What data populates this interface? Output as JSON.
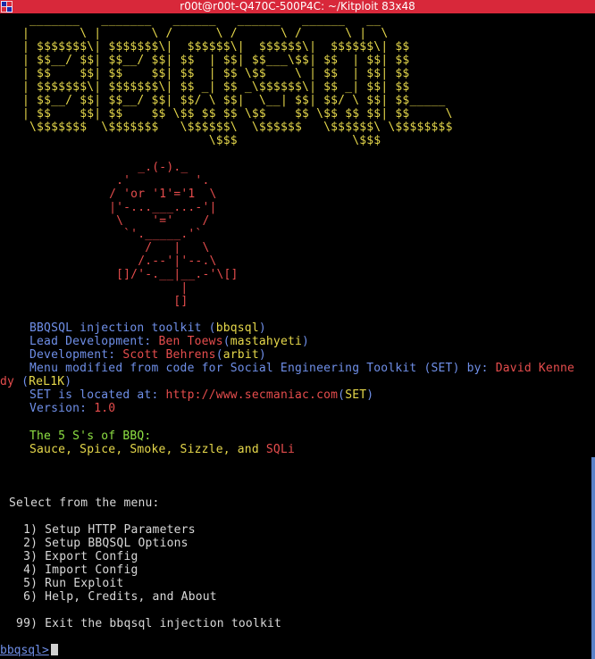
{
  "window": {
    "title": "r00t@r00t-Q470C-500P4C: ~/Kitploit 83x48"
  },
  "ascii_logo": [
    " _______   _______   ______   ______   ______   __",
    "|       \\ |       \\ /      \\ /      \\ /      \\ |  \\",
    "| $$$$$$$\\| $$$$$$$\\|  $$$$$$\\|  $$$$$$\\|  $$$$$$\\| $$",
    "| $$__/ $$| $$__/ $$| $$  | $$| $$___\\$$| $$  | $$| $$",
    "| $$    $$| $$    $$| $$  | $$ \\$$    \\ | $$  | $$| $$",
    "| $$$$$$$\\| $$$$$$$\\| $$ _| $$ _\\$$$$$$\\| $$ _| $$| $$",
    "| $$__/ $$| $$__/ $$| $$/ \\ $$|  \\__| $$| $$/ \\ $$| $$_____",
    "| $$    $$| $$    $$ \\$$ $$ $$ \\$$    $$ \\$$ $$ $$| $$     \\",
    " \\$$$$$$$  \\$$$$$$$   \\$$$$$$\\  \\$$$$$$   \\$$$$$$\\ \\$$$$$$$$",
    "                          \\$$$                \\$$$"
  ],
  "ascii_grill": [
    "        _.(-)._",
    "     .'         '.",
    "    / 'or '1'='1  \\",
    "    |'-...___...-'|",
    "     \\    '='    /",
    "      `'._____.'`",
    "         /   |   \\",
    "        /.--'|'--.\\",
    "     []/'-.__|__.-'\\[]",
    "              |",
    "             []"
  ],
  "info": {
    "toolkit_label": "BBQSQL injection toolkit (",
    "toolkit_name": "bbqsql",
    "toolkit_close": ")",
    "lead_label": "Lead Development: ",
    "lead_name": "Ben Toews",
    "lead_paren_open": "(",
    "lead_handle": "mastahyeti",
    "lead_paren_close": ")",
    "dev_label": "Development: ",
    "dev_name": "Scott Behrens",
    "dev_paren_open": "(",
    "dev_handle": "arbit",
    "dev_paren_close": ")",
    "menu_label": "Menu modified from code for Social Engineering Toolkit (SET) by: ",
    "menu_author_part1": "David Kenne",
    "menu_author_part2": "dy",
    "menu_paren_open": " (",
    "menu_handle": "ReL1K",
    "menu_paren_close": ")",
    "set_label": "SET is located at: ",
    "set_url": "http://www.secmaniac.com",
    "set_paren_open": "(",
    "set_name": "SET",
    "set_paren_close": ")",
    "version_label": "Version: ",
    "version_value": "1.0",
    "five_s": "The 5 S's of BBQ:",
    "s_list_prefix": "Sauce, Spice, Smoke, Sizzle, and ",
    "s_list_last": "SQLi"
  },
  "menu": {
    "prompt_heading": " Select from the menu:",
    "items": [
      "   1) Setup HTTP Parameters",
      "   2) Setup BBQSQL Options",
      "   3) Export Config",
      "   4) Import Config",
      "   5) Run Exploit",
      "   6) Help, Credits, and About"
    ],
    "exit_item": "  99) Exit the bbqsql injection toolkit"
  },
  "prompt": {
    "text": "bbqsql>"
  },
  "colors": {
    "titlebar": "#d8283a",
    "logo": "#e6d84b",
    "grill": "#e64d4d",
    "info": "#6f8fe8",
    "highlight": "#e6d84b",
    "five_s": "#8ee043",
    "scroll_thumb": "#5a82c8"
  }
}
